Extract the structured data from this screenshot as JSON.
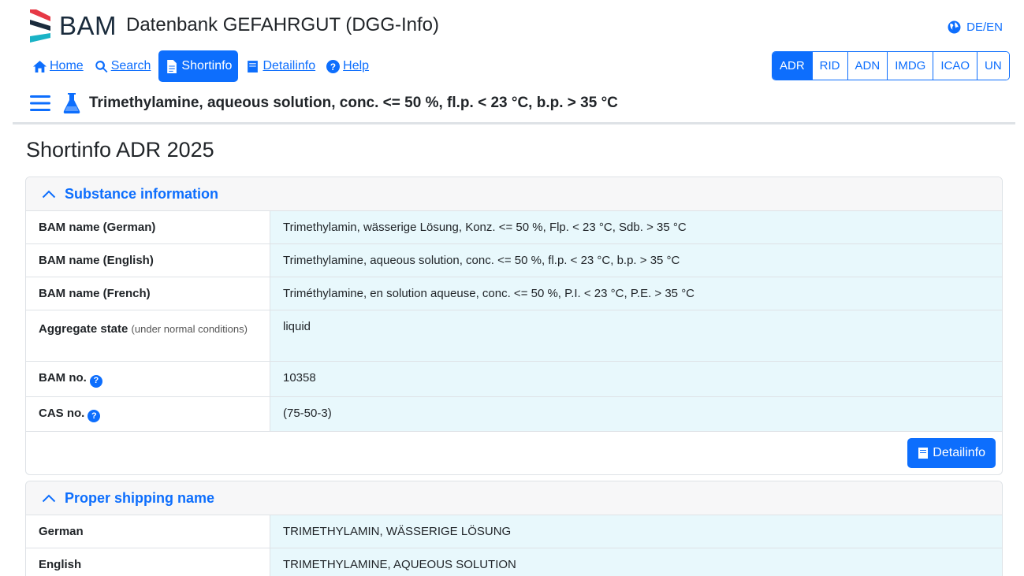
{
  "brand": {
    "logo_text": "BAM",
    "app_title": "Datenbank GEFAHRGUT (DGG-Info)"
  },
  "lang": {
    "label": "DE/EN",
    "icon": "globe-icon"
  },
  "nav": {
    "home": "Home",
    "search": "Search",
    "shortinfo": "Shortinfo",
    "detailinfo": "Detailinfo",
    "help": "Help"
  },
  "regulations": [
    "ADR",
    "RID",
    "ADN",
    "IMDG",
    "ICAO",
    "UN"
  ],
  "active_regulation": "ADR",
  "substance": {
    "title": "Trimethylamine, aqueous solution, conc. <= 50 %, fl.p. < 23 °C, b.p. > 35 °C"
  },
  "page_heading": "Shortinfo ADR 2025",
  "substance_info": {
    "title": "Substance information",
    "rows": [
      {
        "label": "BAM name (German)",
        "value": "Trimethylamin, wässerige Lösung, Konz. <= 50 %, Flp. < 23 °C, Sdb. > 35 °C"
      },
      {
        "label": "BAM name (English)",
        "value": "Trimethylamine, aqueous solution, conc. <= 50 %, fl.p. < 23 °C, b.p. > 35 °C"
      },
      {
        "label": "BAM name (French)",
        "value": "Triméthylamine, en solution aqueuse, conc. <= 50 %, P.I. < 23 °C, P.E. > 35 °C"
      },
      {
        "label": "Aggregate state",
        "note": "(under normal conditions)",
        "value": "liquid"
      },
      {
        "label": "BAM no.",
        "value": "10358"
      },
      {
        "label": "CAS no.",
        "value": "(75-50-3)"
      }
    ],
    "button": "Detailinfo"
  },
  "shipping": {
    "title": "Proper shipping name",
    "rows": [
      {
        "label": "German",
        "value": "TRIMETHYLAMIN, WÄSSERIGE LÖSUNG"
      },
      {
        "label": "English",
        "value": "TRIMETHYLAMINE, AQUEOUS SOLUTION"
      }
    ]
  },
  "colors": {
    "primary": "#0d6efd",
    "value_bg": "#e8f8fc",
    "header_bg": "#f7f7f8"
  }
}
